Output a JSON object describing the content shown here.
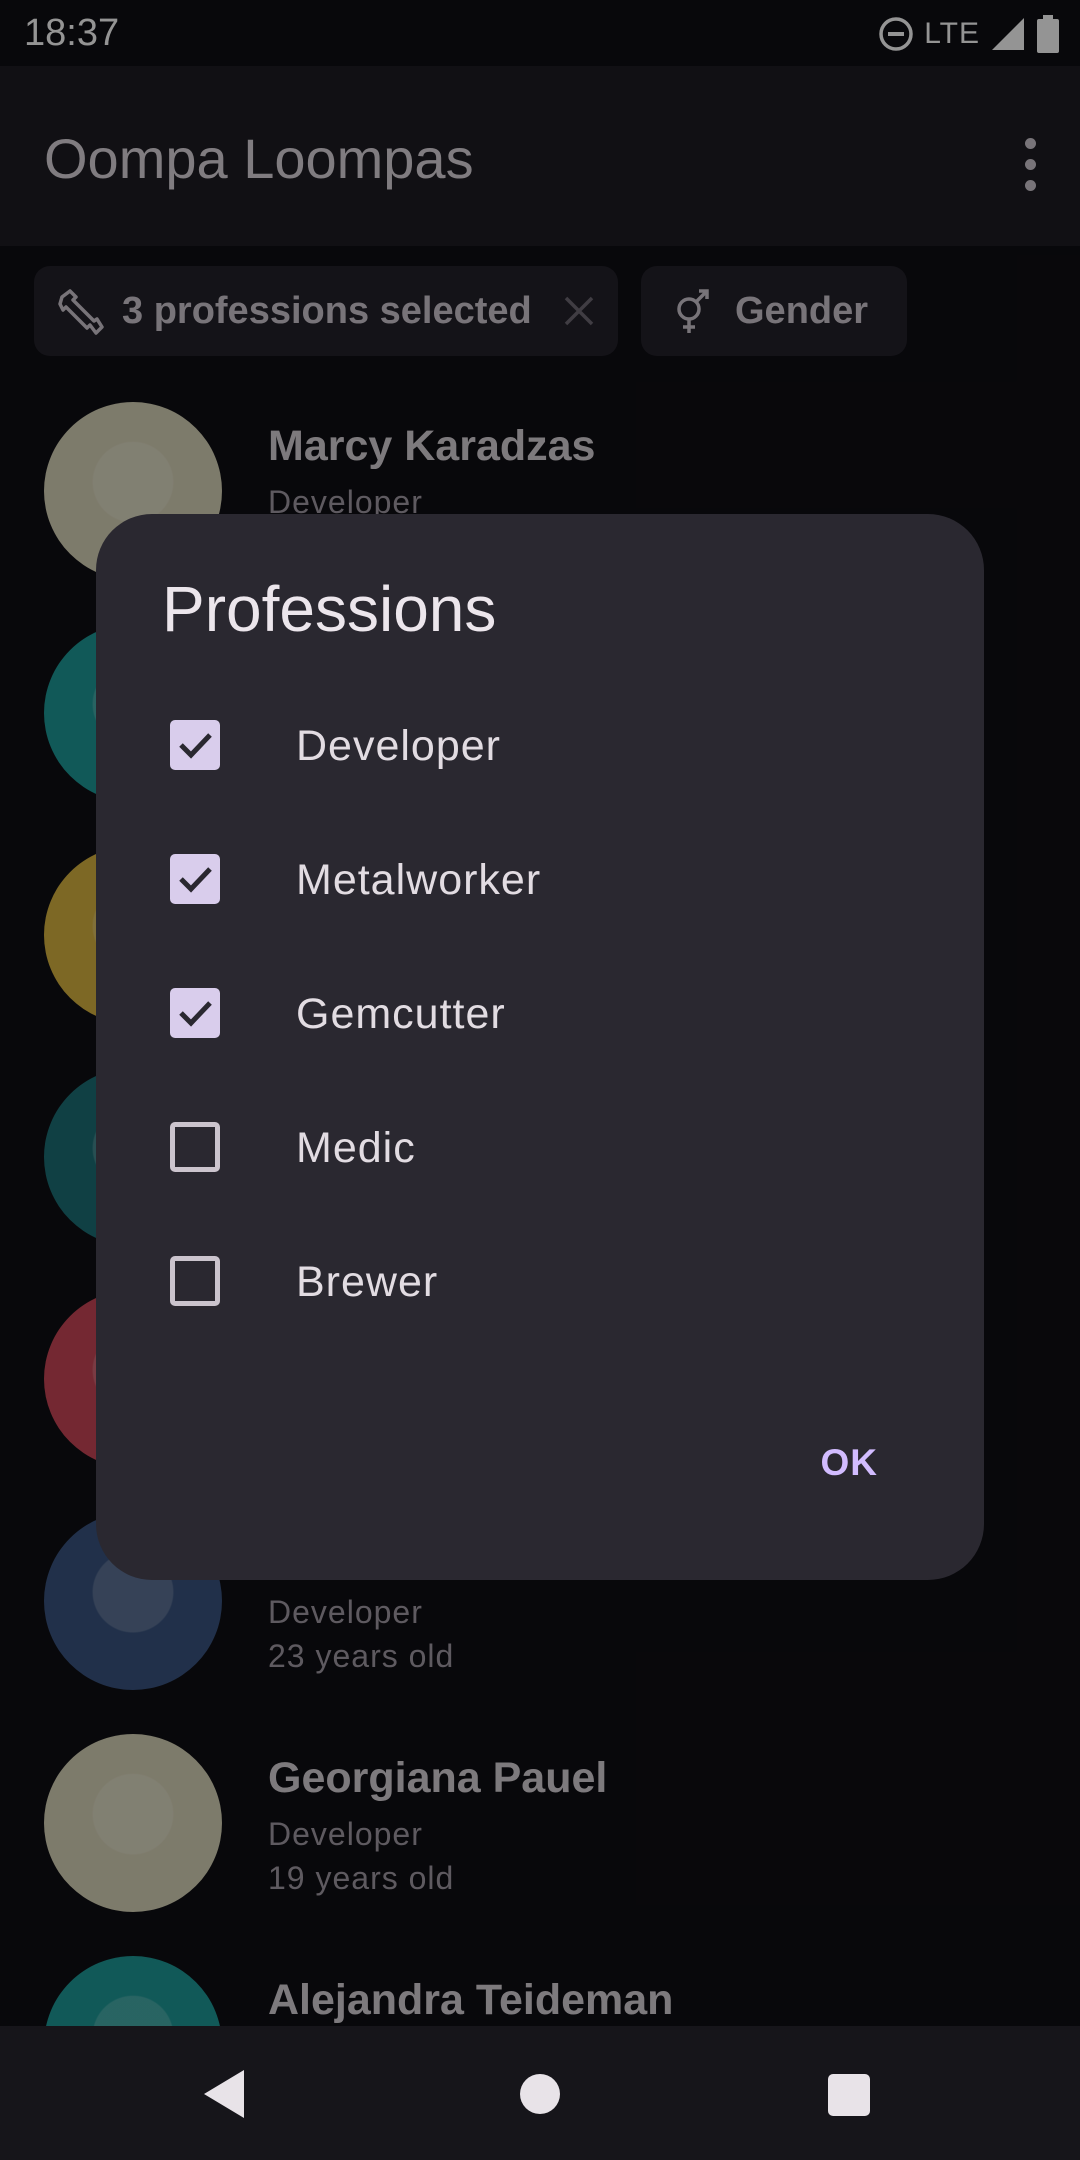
{
  "status_bar": {
    "time": "18:37",
    "network": "LTE"
  },
  "app_bar": {
    "title": "Oompa Loompas"
  },
  "filters": {
    "professions_chip": "3 professions selected",
    "gender_chip": "Gender"
  },
  "people": [
    {
      "name": "Marcy Karadzas",
      "profession": "Developer",
      "age": "",
      "avatar_color": "#d8d4b8"
    },
    {
      "name": "",
      "profession": "",
      "age": "",
      "avatar_color": "#1e9a98"
    },
    {
      "name": "",
      "profession": "",
      "age": "",
      "avatar_color": "#d8b440"
    },
    {
      "name": "",
      "profession": "",
      "age": "",
      "avatar_color": "#1c6f76"
    },
    {
      "name": "",
      "profession": "",
      "age": "",
      "avatar_color": "#c84656"
    },
    {
      "name": "",
      "profession": "Developer",
      "age": "23 years old",
      "avatar_color": "#3a5480"
    },
    {
      "name": "Georgiana Pauel",
      "profession": "Developer",
      "age": "19 years old",
      "avatar_color": "#d8d4b8"
    },
    {
      "name": "Alejandra Teideman",
      "profession": "",
      "age": "",
      "avatar_color": "#1e9a98"
    }
  ],
  "dialog": {
    "title": "Professions",
    "options": [
      {
        "label": "Developer",
        "checked": true
      },
      {
        "label": "Metalworker",
        "checked": true
      },
      {
        "label": "Gemcutter",
        "checked": true
      },
      {
        "label": "Medic",
        "checked": false
      },
      {
        "label": "Brewer",
        "checked": false
      }
    ],
    "ok_label": "OK"
  },
  "colors": {
    "accent": "#d2bcff",
    "checkbox_fill": "#d9cdec",
    "dialog_surface": "#2a2830"
  }
}
